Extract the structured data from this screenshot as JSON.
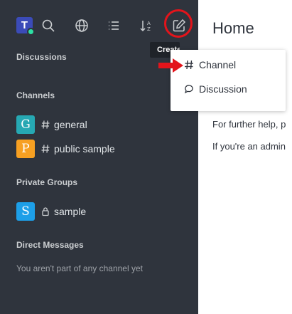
{
  "sidebar": {
    "user_initial": "T",
    "sections": {
      "discussions": "Discussions",
      "channels": "Channels",
      "private_groups": "Private Groups",
      "direct_messages": "Direct Messages"
    },
    "channels": [
      {
        "initial": "G",
        "name": "general",
        "color": "#26a8b3"
      },
      {
        "initial": "P",
        "name": "public sample",
        "color": "#f7a022"
      }
    ],
    "private_groups": [
      {
        "initial": "S",
        "name": "sample",
        "color": "#1d9fe8"
      }
    ],
    "direct_messages_empty": "You aren't part of any channel yet"
  },
  "toolbar": {
    "icons": [
      "search-icon",
      "directory-globe-icon",
      "display-list-icon",
      "sort-icon",
      "create-new-icon"
    ],
    "tooltip": "Create new"
  },
  "create_menu": {
    "items": [
      {
        "label": "Channel",
        "icon": "hash-icon"
      },
      {
        "label": "Discussion",
        "icon": "discussion-icon"
      }
    ]
  },
  "main": {
    "title": "Home",
    "line_1": "For further help, p",
    "line_2": "If you're an admin"
  },
  "colors": {
    "sidebar_bg": "#2f343d",
    "annotation_red": "#e3141b",
    "status_online": "#2de0a5"
  }
}
